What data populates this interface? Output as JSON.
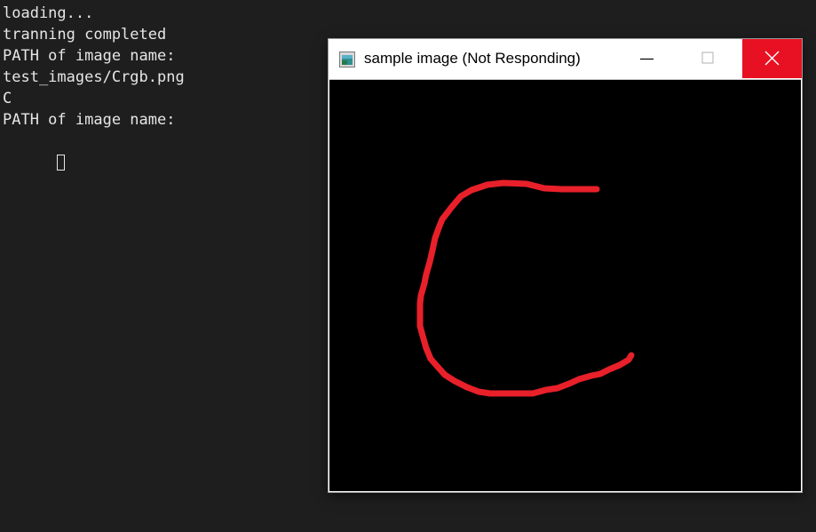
{
  "terminal": {
    "top_partial": {
      "left": "",
      "middle": "",
      "right": ""
    },
    "lines": [
      "loading...",
      "tranning completed",
      "PATH of image name:",
      "test_images/Crgb.png",
      "C",
      "PATH of image name:"
    ]
  },
  "window": {
    "title": "sample image (Not Responding)",
    "controls": {
      "minimize_icon": "minimize-icon",
      "maximize_icon": "maximize-icon",
      "close_icon": "close-icon"
    },
    "image": {
      "content": "handwritten-letter-C",
      "stroke_color": "#e8202a",
      "background": "#000000"
    }
  },
  "colors": {
    "terminal_bg": "#1e1e1e",
    "terminal_text": "#e6e6e6",
    "close_button": "#e81123"
  }
}
